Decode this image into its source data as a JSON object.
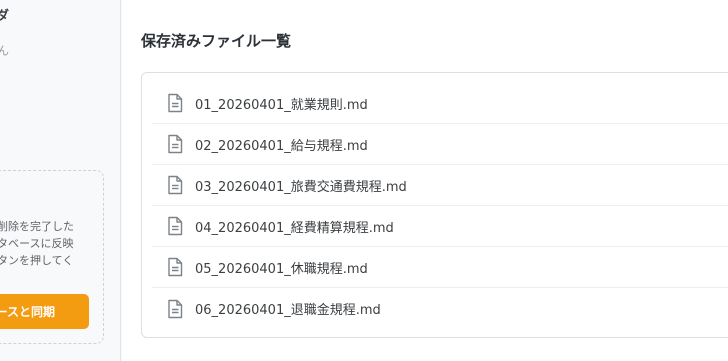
{
  "sidebar": {
    "heading": "ルダ",
    "empty_text": "せん",
    "sync_card": {
      "description_lines": [
        "削除を完了した",
        "タベースに反映",
        "タンを押してく"
      ],
      "button_label": "ースと同期",
      "button_color": "#f39c12"
    }
  },
  "main": {
    "title": "保存済みファイル一覧",
    "file_icon": "document-icon",
    "files": [
      {
        "name": "01_20260401_就業規則.md"
      },
      {
        "name": "02_20260401_給与規程.md"
      },
      {
        "name": "03_20260401_旅費交通費規程.md"
      },
      {
        "name": "04_20260401_経費精算規程.md"
      },
      {
        "name": "05_20260401_休職規程.md"
      },
      {
        "name": "06_20260401_退職金規程.md"
      }
    ]
  }
}
